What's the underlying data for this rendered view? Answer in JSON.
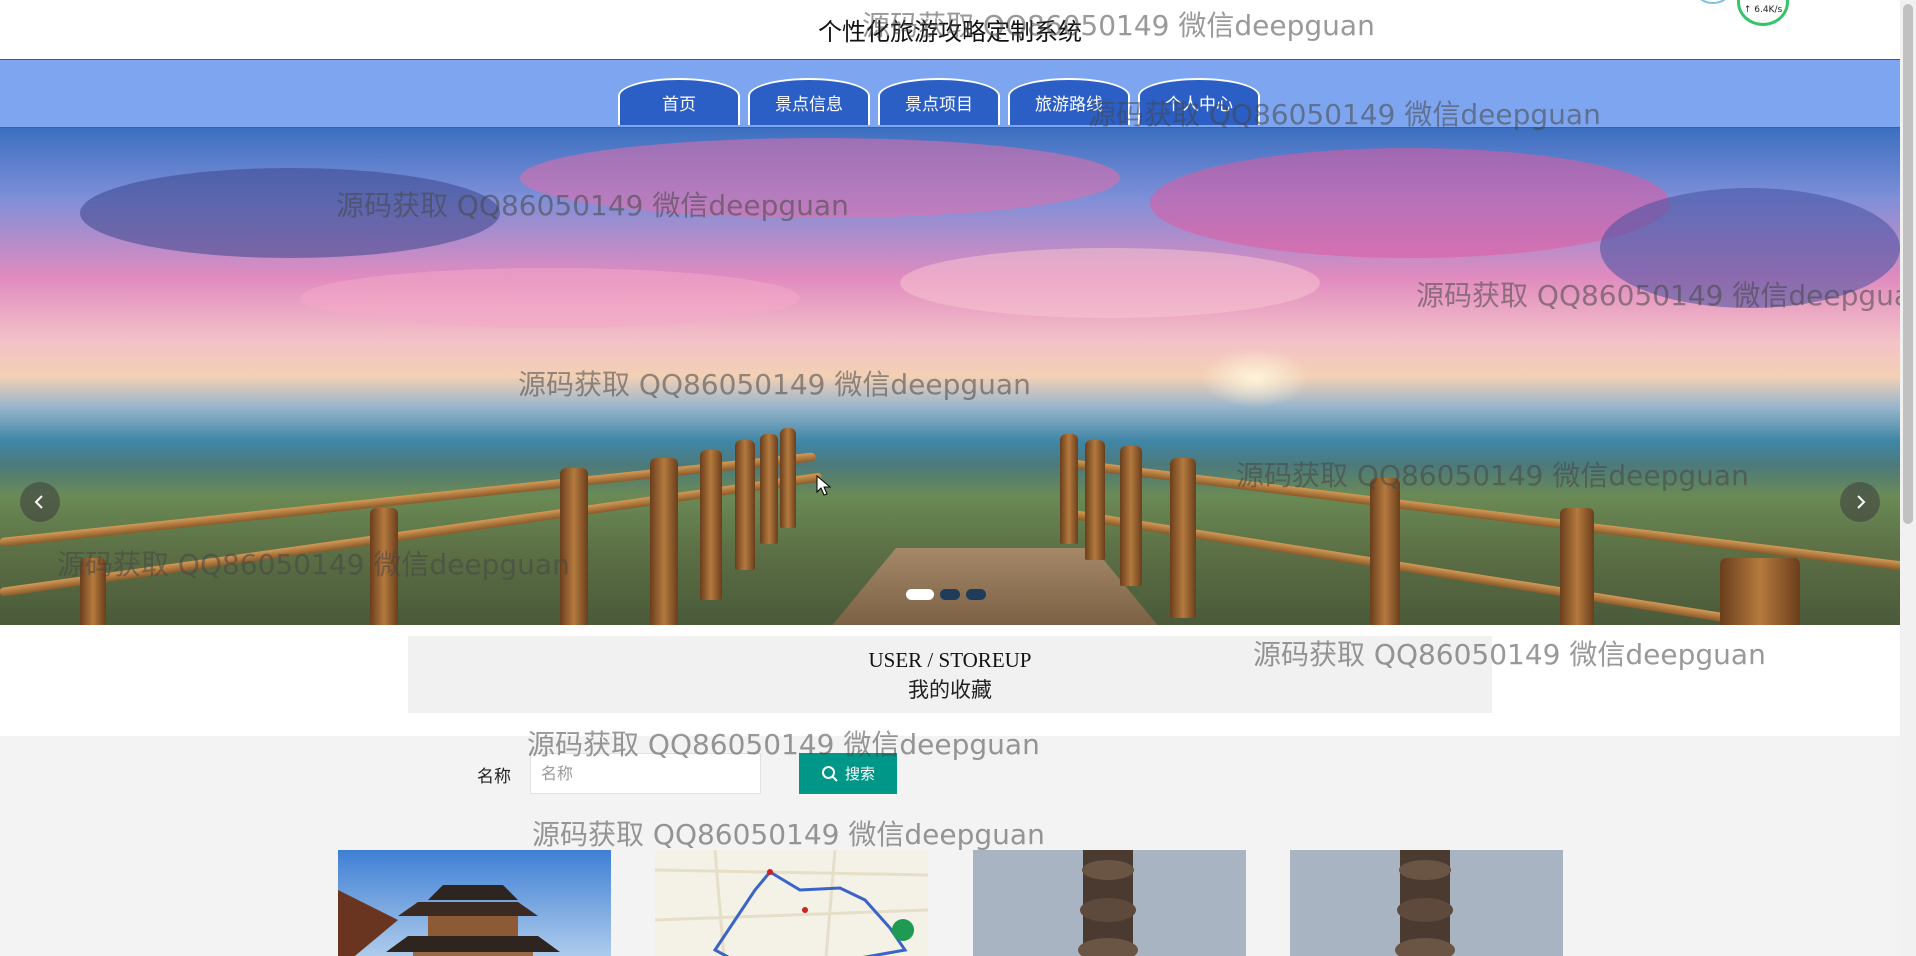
{
  "header": {
    "title": "个性化旅游攻略定制系统"
  },
  "nav": {
    "items": [
      "首页",
      "景点信息",
      "景点项目",
      "旅游路线",
      "个人中心"
    ]
  },
  "carousel": {
    "slide_count": 3,
    "active_index": 0
  },
  "section": {
    "title_en": "USER / STOREUP",
    "title_cn": "我的收藏"
  },
  "search": {
    "label": "名称",
    "placeholder": "名称",
    "value": "",
    "button_label": "搜索"
  },
  "watermark": {
    "text": "源码获取 QQ86050149 微信deepguan"
  },
  "speed_widget": {
    "text": "↑ 6.4K/s"
  },
  "colors": {
    "nav_bg": "#7ea6f0",
    "tab_bg": "#2c5fc5",
    "search_button": "#009688"
  },
  "icons": [
    "chevron-left-icon",
    "chevron-right-icon",
    "search-icon"
  ]
}
